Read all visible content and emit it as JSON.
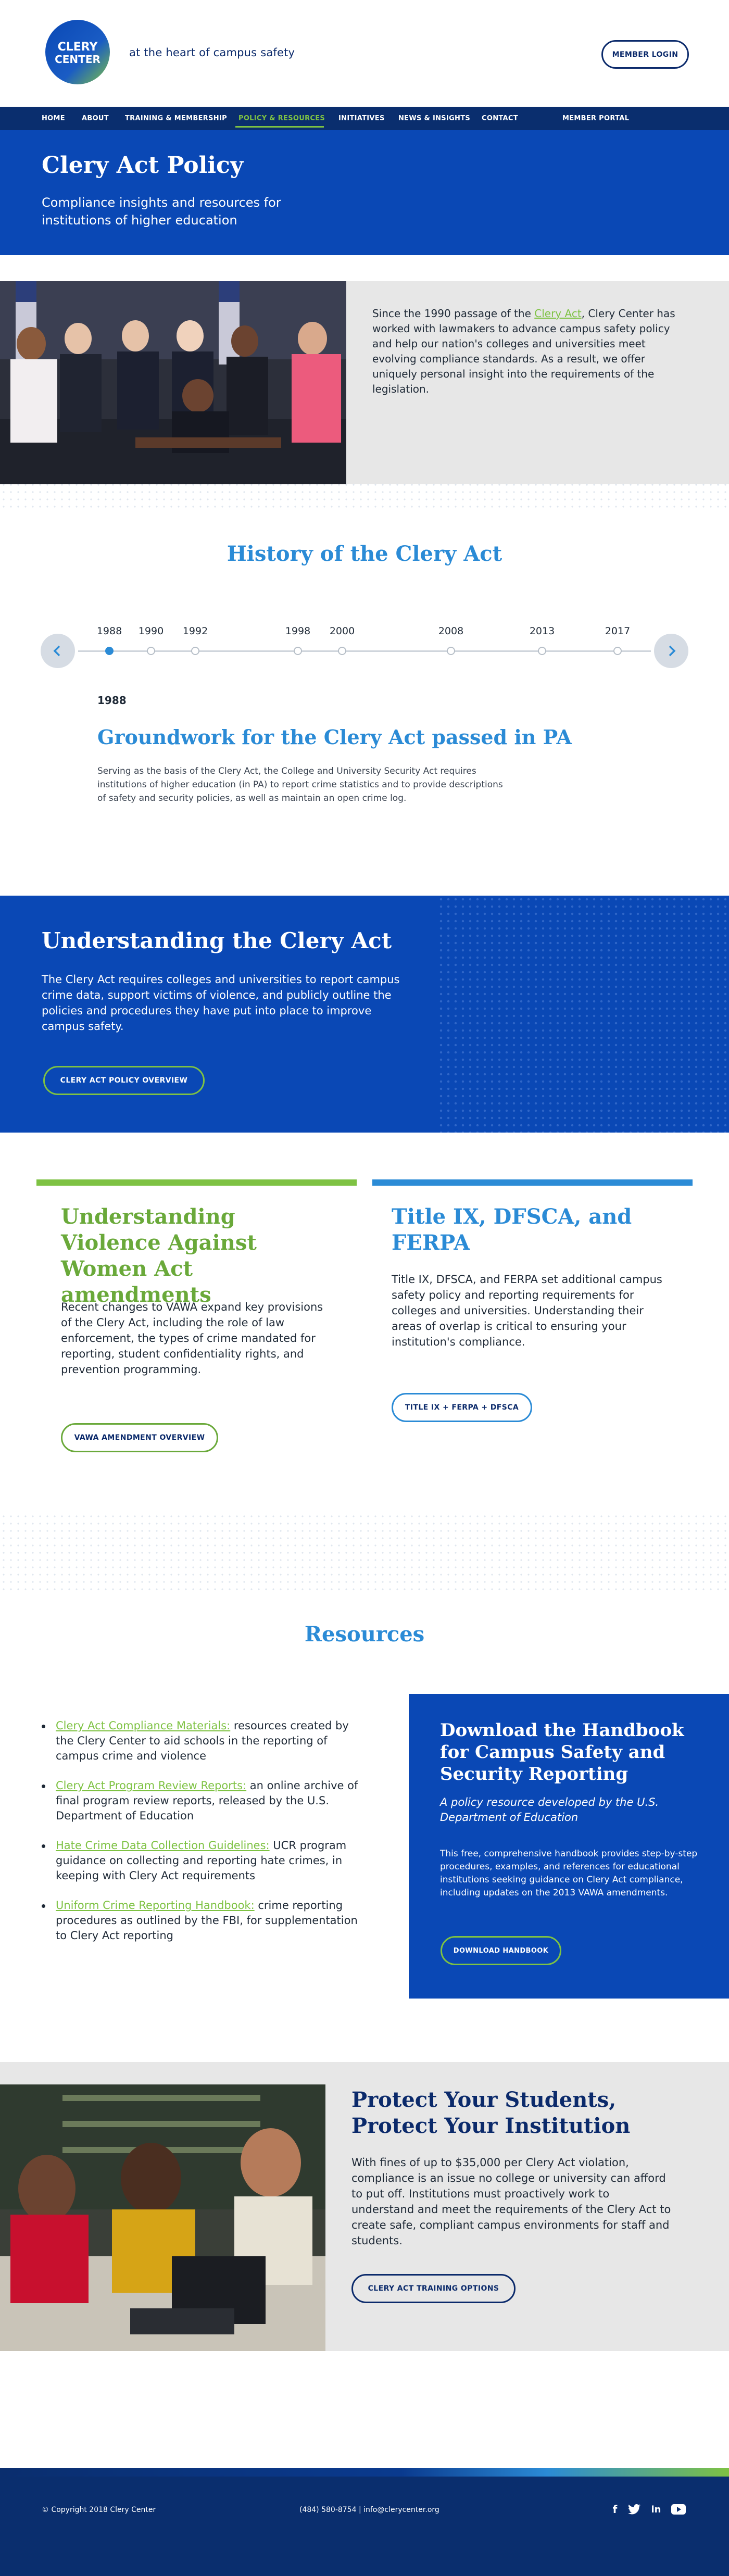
{
  "header": {
    "logo_text": "CLERY CENTER",
    "tagline": "at the heart of campus safety",
    "member_login": "MEMBER LOGIN"
  },
  "nav": {
    "items": [
      {
        "label": "HOME"
      },
      {
        "label": "ABOUT"
      },
      {
        "label": "TRAINING & MEMBERSHIP"
      },
      {
        "label": "POLICY & RESOURCES"
      },
      {
        "label": "INITIATIVES"
      },
      {
        "label": "NEWS & INSIGHTS"
      },
      {
        "label": "CONTACT"
      },
      {
        "label": "MEMBER PORTAL"
      }
    ],
    "active": "POLICY & RESOURCES"
  },
  "hero": {
    "title": "Clery Act Policy",
    "subtitle": "Compliance insights and resources for institutions of higher education"
  },
  "intro": {
    "text_before": "Since the 1990 passage of the ",
    "link": "Clery Act",
    "text_after": ", Clery Center has worked with lawmakers to advance campus safety policy and help our nation's colleges and universities meet evolving compliance standards. As a result, we offer uniquely personal insight into the requirements of the legislation."
  },
  "history": {
    "title": "History of the Clery Act",
    "years": [
      "1988",
      "1990",
      "1992",
      "1998",
      "2000",
      "2008",
      "2013",
      "2017"
    ],
    "active_year": "1988",
    "selected": {
      "year": "1988",
      "heading": "Groundwork for the Clery Act passed in PA",
      "body": "Serving as the basis of the Clery Act, the College and University Security Act requires institutions of higher education (in PA) to report crime statistics and to provide descriptions of safety and security policies, as well as maintain an open crime log."
    }
  },
  "understanding": {
    "title_light": "Understanding ",
    "title_bold": "the Clery Act",
    "body": "The Clery Act requires colleges and universities to report campus crime data, support victims of violence, and publicly outline the policies and procedures they have put into place to improve campus safety.",
    "button": "CLERY ACT POLICY OVERVIEW"
  },
  "vawa": {
    "title_light": "Understanding ",
    "title_bold": "Violence Against Women Act",
    "title_end": " amendments",
    "body": "Recent changes to VAWA expand key provisions of the Clery Act, including the role of law enforcement, the types of crime mandated for reporting, student confidentiality rights, and prevention programming.",
    "button": "VAWA AMENDMENT OVERVIEW"
  },
  "title9": {
    "title": "Title IX, DFSCA, and FERPA",
    "body": "Title IX, DFSCA, and FERPA set additional campus safety policy and reporting requirements for colleges and universities. Understanding their areas of overlap is critical to ensuring your institution's compliance.",
    "button": "TITLE IX + FERPA + DFSCA"
  },
  "resources": {
    "title": "Resources",
    "items": [
      {
        "link": "Clery Act Compliance Materials:",
        "text": " resources created by the Clery Center to aid schools in the reporting of campus crime and violence"
      },
      {
        "link": "Clery Act Program Review Reports:",
        "text": " an online archive of final program review reports, released by the U.S. Department of Education"
      },
      {
        "link": "Hate Crime Data Collection Guidelines:",
        "text": " UCR program guidance on collecting and reporting hate crimes, in keeping with Clery Act requirements"
      },
      {
        "link": "Uniform Crime Reporting Handbook:",
        "text": " crime reporting procedures as outlined by the FBI, for supplementation to Clery Act reporting"
      }
    ]
  },
  "handbook": {
    "title": "Download the Handbook for Campus Safety and Security Reporting",
    "subtitle": "A policy resource developed by the U.S. Department of Education",
    "body": "This free, comprehensive handbook provides step-by-step procedures, examples, and references for educational institutions seeking guidance on Clery Act compliance, including updates on the 2013 VAWA amendments.",
    "button": "DOWNLOAD HANDBOOK"
  },
  "protect": {
    "title": "Protect Your Students, Protect Your Institution",
    "body": "With fines of up to $35,000 per Clery Act violation, compliance is an issue no college or university can afford to put off. Institutions must proactively work to understand and meet the requirements of the Clery Act to create safe, compliant campus environments for staff and students.",
    "button": "CLERY ACT TRAINING OPTIONS"
  },
  "footer": {
    "copyright": "© Copyright 2018 Clery Center",
    "contact": "(484) 580-8754 | info@clerycenter.org",
    "social": [
      {
        "icon": "facebook-icon",
        "glyph": "f"
      },
      {
        "icon": "twitter-icon",
        "glyph": "🐦"
      },
      {
        "icon": "linkedin-icon",
        "glyph": "in"
      },
      {
        "icon": "youtube-icon",
        "glyph": "▶"
      }
    ]
  },
  "colors": {
    "navy": "#0a2e6e",
    "blue": "#0a48b5",
    "sky": "#2b8bd6",
    "green": "#7ec243"
  }
}
